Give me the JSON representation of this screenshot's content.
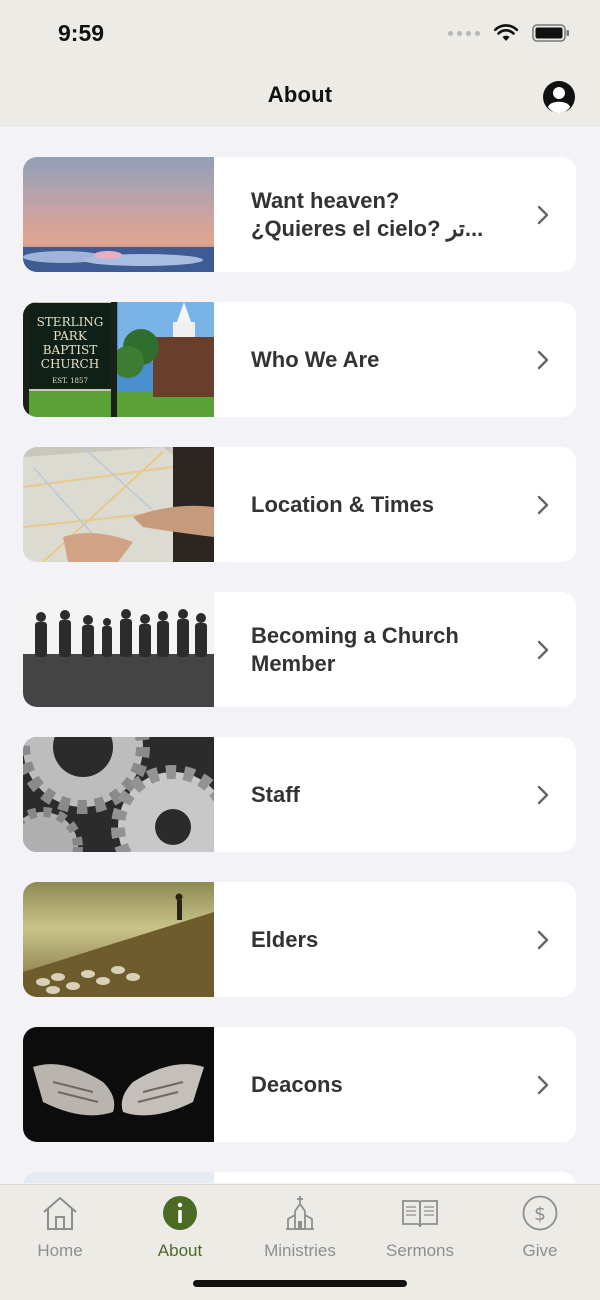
{
  "status_bar": {
    "time": "9:59"
  },
  "nav": {
    "title": "About"
  },
  "items": [
    {
      "line1": "Want heaven?",
      "line2": "¿Quieres el cielo? تر...",
      "image": "sky-photo"
    },
    {
      "line1": "Who We Are",
      "line2": "",
      "image": "church-sign-photo"
    },
    {
      "line1": "Location & Times",
      "line2": "",
      "image": "map-photo"
    },
    {
      "line1": "Becoming a Church",
      "line2": "Member",
      "image": "silhouettes-photo"
    },
    {
      "line1": "Staff",
      "line2": "",
      "image": "gears-photo"
    },
    {
      "line1": "Elders",
      "line2": "",
      "image": "shepherd-photo"
    },
    {
      "line1": "Deacons",
      "line2": "",
      "image": "hands-photo"
    }
  ],
  "church_sign": {
    "lines": [
      "STERLING",
      "PARK",
      "BAPTIST",
      "CHURCH"
    ],
    "est": "EST. 1857"
  },
  "tabs": [
    {
      "label": "Home",
      "icon": "house-icon",
      "active": false
    },
    {
      "label": "About",
      "icon": "info-icon",
      "active": true
    },
    {
      "label": "Ministries",
      "icon": "church-icon",
      "active": false
    },
    {
      "label": "Sermons",
      "icon": "book-icon",
      "active": false
    },
    {
      "label": "Give",
      "icon": "dollar-icon",
      "active": false
    }
  ],
  "colors": {
    "accent": "#4b6a23",
    "inactive": "#8e8e8e",
    "bar_bg": "#edebe6",
    "page_bg": "#f2f2f7"
  }
}
